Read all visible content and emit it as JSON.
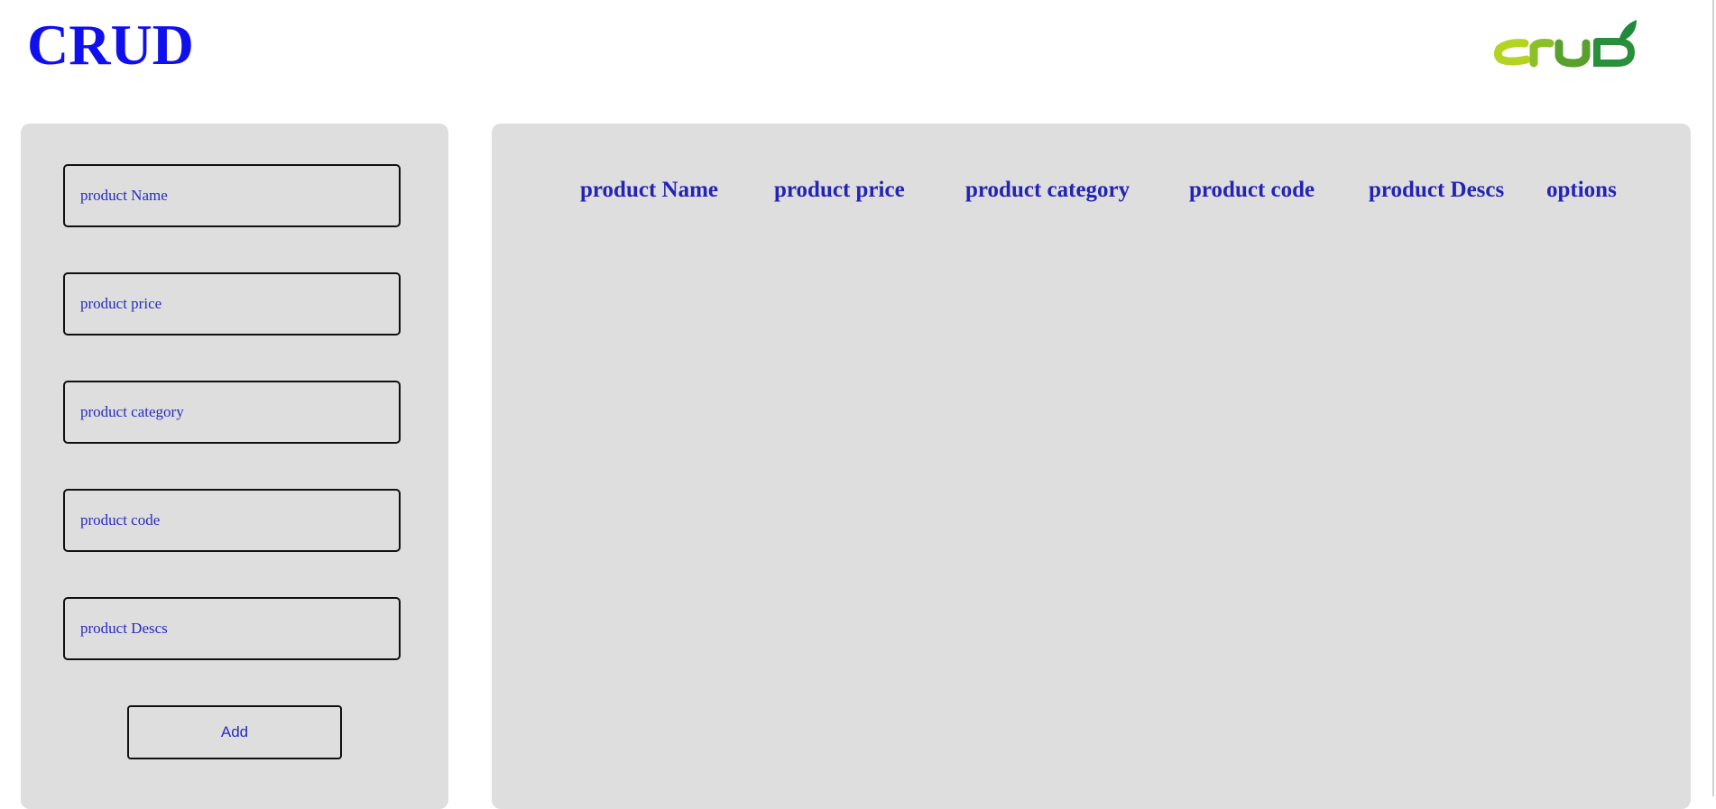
{
  "header": {
    "title": "CRUD",
    "logo_text": "crud",
    "logo_colors": [
      "#b5d322",
      "#5aa02c",
      "#1e8a3a"
    ]
  },
  "form": {
    "fields": [
      {
        "placeholder": "product Name",
        "value": ""
      },
      {
        "placeholder": "product price",
        "value": ""
      },
      {
        "placeholder": "product category",
        "value": ""
      },
      {
        "placeholder": "product code",
        "value": ""
      },
      {
        "placeholder": "product Descs",
        "value": ""
      }
    ],
    "add_label": "Add"
  },
  "table": {
    "headers": [
      "product Name",
      "product price",
      "product category",
      "product code",
      "product Descs",
      "options"
    ],
    "rows": []
  },
  "colors": {
    "accent": "#1010ee",
    "text": "#2323b8",
    "panel": "#dedede"
  }
}
